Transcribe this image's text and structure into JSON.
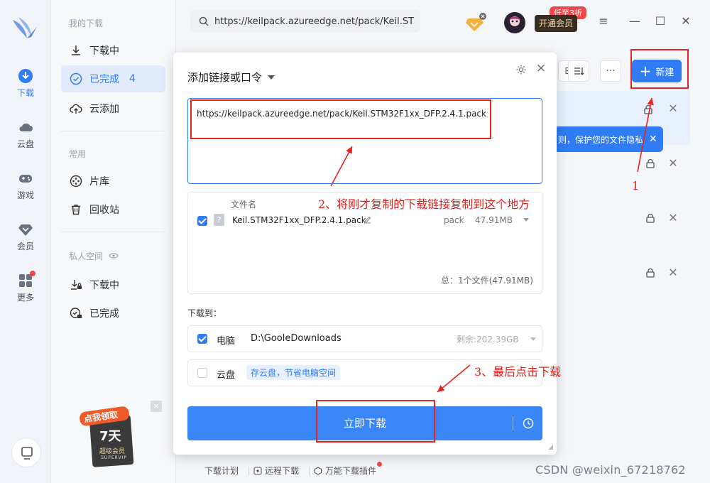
{
  "rail": {
    "items": [
      {
        "label": "下载",
        "icon": "download-icon"
      },
      {
        "label": "云盘",
        "icon": "cloud-icon"
      },
      {
        "label": "游戏",
        "icon": "gamepad-icon"
      },
      {
        "label": "会员",
        "icon": "diamond-icon"
      },
      {
        "label": "更多",
        "icon": "grid-icon"
      }
    ]
  },
  "nav": {
    "section_my": "我的下载",
    "downloading": "下载中",
    "completed": "已完成",
    "completed_count": "4",
    "cloud_add": "云添加",
    "section_common": "常用",
    "library": "片库",
    "recycle": "回收站",
    "section_private": "私人空间",
    "private_downloading": "下载中",
    "private_completed": "已完成"
  },
  "promo": {
    "line1": "点我领取",
    "days": "7天",
    "line3": "超级会员",
    "line4": "SUPERVIP",
    "close": "×"
  },
  "topbar": {
    "url": "https://keilpack.azureedge.net/pack/Keil.ST",
    "vip_tag": "低至3折",
    "vip_button": "开通会员"
  },
  "toolbar": {
    "new_label": "新建",
    "more_label": "···"
  },
  "background": {
    "tooltip_text": "则，保护您的文件隐私"
  },
  "dialog": {
    "title": "添加链接或口令",
    "link_text": "https://keilpack.azureedge.net/pack/Keil.STM32F1xx_DFP.2.4.1.pack",
    "col_filename": "文件名",
    "file_name": "Keil.STM32F1xx_DFP.2.4.1.pack",
    "file_type": "pack",
    "file_size": "47.91MB",
    "total": "总：1个文件(47.91MB)",
    "download_to": "下载到：",
    "pc_label": "电脑",
    "pc_path": "D:\\GooleDownloads",
    "pc_free": "剩余:202.39GB",
    "cloud_label": "云盘",
    "cloud_tag": "存云盘，节省电脑空间",
    "download_button": "立即下载",
    "close": "×"
  },
  "bottom": {
    "plan": "下载计划",
    "remote": "远程下载",
    "plugin": "万能下载插件"
  },
  "annotations": {
    "a1": "1",
    "a2": "2、将刚才复制的下载链接复制到这个地方",
    "a3": "3、最后点击下载"
  },
  "watermark": "CSDN @weixin_67218762",
  "colors": {
    "accent": "#2f7cf6",
    "annotation": "#e6231e",
    "vip_tag": "#f04848"
  }
}
